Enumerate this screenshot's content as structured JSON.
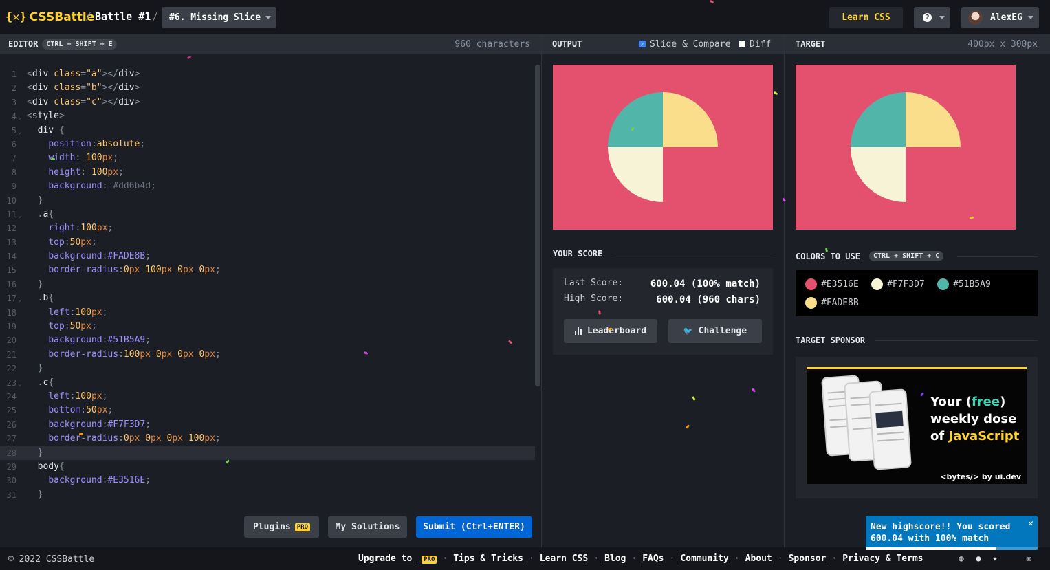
{
  "header": {
    "battle_link": "Battle #1",
    "separator": "/",
    "target_select": "#6. Missing Slice",
    "learn_css": "Learn CSS",
    "help_glyph": "?",
    "user_name": "AlexEG"
  },
  "editor": {
    "title": "EDITOR",
    "shortcut": "CTRL + SHIFT + E",
    "char_count": "960 characters",
    "plugins_label": "Plugins",
    "pro_badge": "PRO",
    "my_solutions_label": "My Solutions",
    "submit_label": "Submit (Ctrl+ENTER)"
  },
  "output": {
    "title": "OUTPUT",
    "slide_compare_label": "Slide & Compare",
    "diff_label": "Diff"
  },
  "target": {
    "title": "TARGET",
    "size": "400px x 300px"
  },
  "score": {
    "section_title": "YOUR SCORE",
    "last_label": "Last Score:",
    "last_value": "600.04 (100% match)",
    "high_label": "High Score:",
    "high_value": "600.04 (960 chars)",
    "leaderboard_label": "Leaderboard",
    "challenge_label": "Challenge"
  },
  "colors": {
    "section_title": "COLORS TO USE",
    "shortcut": "CTRL + SHIFT + C",
    "list": [
      {
        "label": "#E3516E",
        "hex": "#e3516e"
      },
      {
        "label": "#F7F3D7",
        "hex": "#f7f3d7"
      },
      {
        "label": "#51B5A9",
        "hex": "#51b5a9"
      },
      {
        "label": "#FADE8B",
        "hex": "#fade8b"
      }
    ]
  },
  "sponsor": {
    "section_title": "TARGET SPONSOR",
    "line1_a": "Your (",
    "line1_b": "free",
    "line1_c": ")",
    "line2": "weekly dose",
    "line3_a": "of ",
    "line3_b": "JavaScript",
    "footer": "<bytes/> by ui.dev"
  },
  "toast": {
    "message": "New highscore!! You scored 600.04 with 100% match",
    "close": "✕",
    "progress": 0.76
  },
  "footer": {
    "copyright": "© 2022 CSSBattle",
    "upgrade": "Upgrade to",
    "links": [
      "Tips & Tricks",
      "Learn CSS",
      "Blog",
      "FAQs",
      "Community",
      "About",
      "Sponsor",
      "Privacy & Terms"
    ]
  },
  "palette": {
    "accent": "#ffd230",
    "submit": "#0066d6",
    "toast": "#0277bd"
  }
}
